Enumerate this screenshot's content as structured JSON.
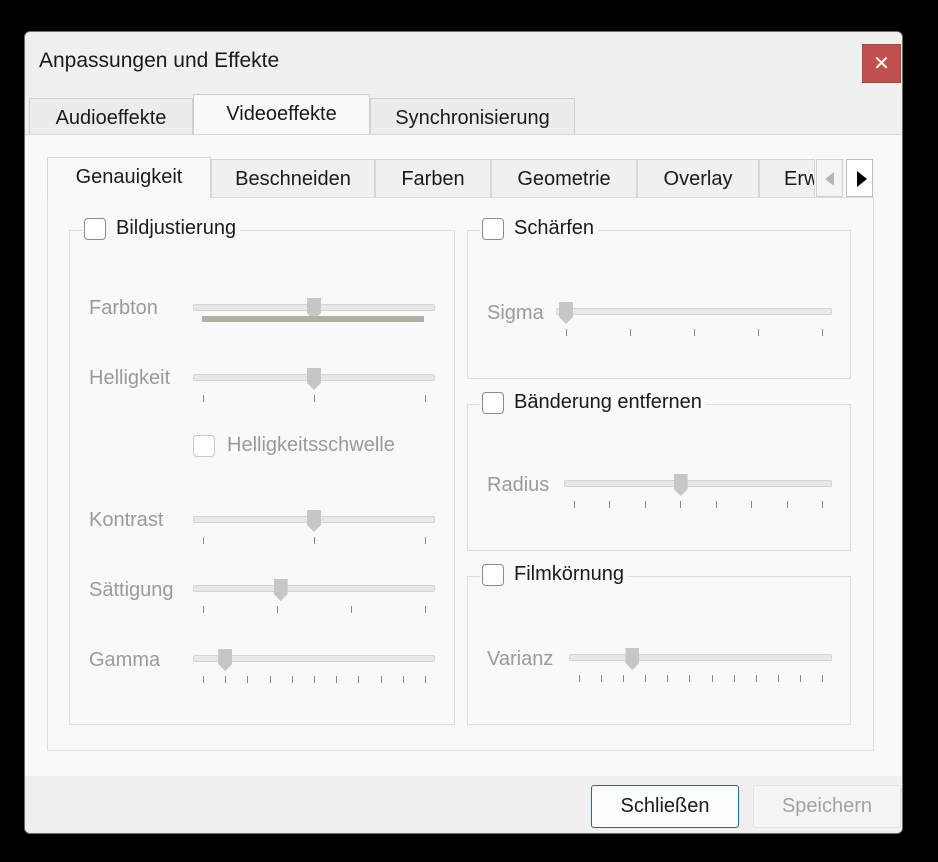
{
  "window": {
    "title": "Anpassungen und Effekte",
    "close_glyph": "✕"
  },
  "outer_tabs": [
    {
      "label": "Audioeffekte",
      "active": false
    },
    {
      "label": "Videoeffekte",
      "active": true
    },
    {
      "label": "Synchronisierung",
      "active": false
    }
  ],
  "inner_tabs": [
    {
      "label": "Genauigkeit",
      "active": true
    },
    {
      "label": "Beschneiden",
      "active": false
    },
    {
      "label": "Farben",
      "active": false
    },
    {
      "label": "Geometrie",
      "active": false
    },
    {
      "label": "Overlay",
      "active": false
    },
    {
      "label": "Erw",
      "active": false
    }
  ],
  "bildjustierung": {
    "label": "Bildjustierung",
    "checked": false,
    "farbton": {
      "label": "Farbton",
      "value": 0.5
    },
    "helligkeit": {
      "label": "Helligkeit",
      "value": 0.5
    },
    "helligkeitsschwelle": {
      "label": "Helligkeitsschwelle",
      "checked": false
    },
    "kontrast": {
      "label": "Kontrast",
      "value": 0.5
    },
    "saettigung": {
      "label": "Sättigung",
      "value": 0.35
    },
    "gamma": {
      "label": "Gamma",
      "value": 0.1
    }
  },
  "schaerfen": {
    "label": "Schärfen",
    "checked": false,
    "sigma": {
      "label": "Sigma",
      "value": 0.0
    }
  },
  "baenderung": {
    "label": "Bänderung entfernen",
    "checked": false,
    "radius": {
      "label": "Radius",
      "value": 0.43
    }
  },
  "filmkoernung": {
    "label": "Filmkörnung",
    "checked": false,
    "varianz": {
      "label": "Varianz",
      "value": 0.22
    }
  },
  "footer": {
    "close_label": "Schließen",
    "save_label": "Speichern"
  },
  "colors": {
    "close_button": "#c0504d",
    "primary_border": "#2f62a5",
    "hue_bar": "#b2b0a3"
  }
}
